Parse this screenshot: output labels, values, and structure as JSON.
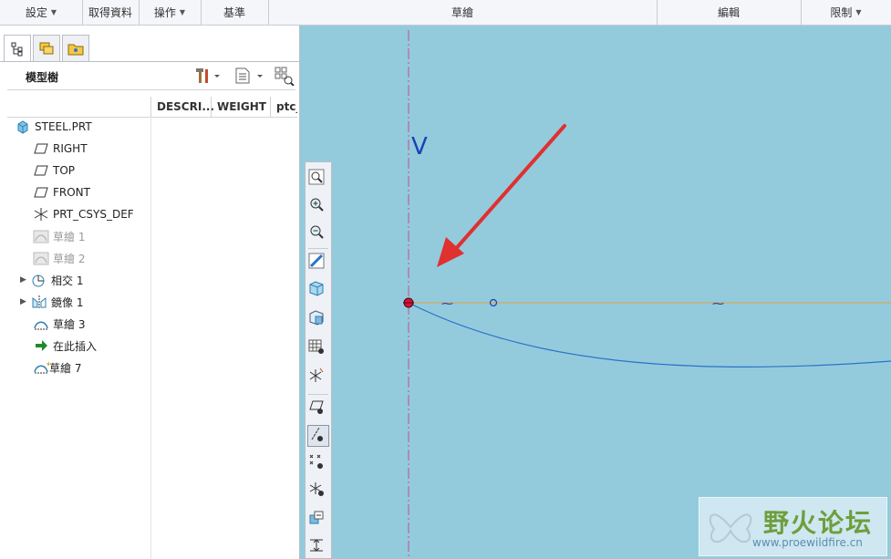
{
  "ribbon": {
    "groups": [
      {
        "label": "設定",
        "dropdown": true
      },
      {
        "label": "取得資料",
        "dropdown": false
      },
      {
        "label": "操作",
        "dropdown": true
      },
      {
        "label": "基準",
        "dropdown": false
      },
      {
        "label": "草繪",
        "dropdown": false
      },
      {
        "label": "編輯",
        "dropdown": false
      },
      {
        "label": "限制",
        "dropdown": true
      }
    ]
  },
  "left_panel": {
    "tabs": [
      {
        "icon": "model-tree-tab-icon",
        "active": true
      },
      {
        "icon": "layers-tab-icon",
        "active": false
      },
      {
        "icon": "favorites-folder-tab-icon",
        "active": false
      }
    ],
    "title": "模型樹",
    "columns": [
      "DESCRI...",
      "WEIGHT",
      "ptc_"
    ],
    "tree": [
      {
        "label": "STEEL.PRT",
        "icon": "part-cube-icon",
        "dim": false,
        "expandable": false,
        "indent": 0
      },
      {
        "label": "RIGHT",
        "icon": "datum-plane-icon",
        "dim": false,
        "expandable": false,
        "indent": 1
      },
      {
        "label": "TOP",
        "icon": "datum-plane-icon",
        "dim": false,
        "expandable": false,
        "indent": 1
      },
      {
        "label": "FRONT",
        "icon": "datum-plane-icon",
        "dim": false,
        "expandable": false,
        "indent": 1
      },
      {
        "label": "PRT_CSYS_DEF",
        "icon": "coordinate-system-icon",
        "dim": false,
        "expandable": false,
        "indent": 1
      },
      {
        "label": "草繪 1",
        "icon": "sketch-icon",
        "dim": true,
        "expandable": false,
        "indent": 1
      },
      {
        "label": "草繪 2",
        "icon": "sketch-icon",
        "dim": true,
        "expandable": false,
        "indent": 1
      },
      {
        "label": "相交 1",
        "icon": "intersect-icon",
        "dim": false,
        "expandable": true,
        "indent": 1
      },
      {
        "label": "鏡像 1",
        "icon": "mirror-icon",
        "dim": false,
        "expandable": true,
        "indent": 1
      },
      {
        "label": "草繪 3",
        "icon": "sketch-icon",
        "dim": false,
        "expandable": false,
        "indent": 1
      },
      {
        "label": "在此插入",
        "icon": "insert-here-arrow-icon",
        "dim": false,
        "expandable": false,
        "indent": 1
      },
      {
        "label": "草繪 7",
        "icon": "sketch-active-icon",
        "dim": false,
        "expandable": false,
        "indent": 1
      }
    ]
  },
  "canvas": {
    "axis_label": "V",
    "background": "#93cbdd",
    "toolbar": [
      "refit-icon",
      "zoom-in-icon",
      "zoom-out-icon",
      "repaint-icon",
      "display-style-icon",
      "saved-orientations-icon",
      "view-manager-icon",
      "datum-display-filters-icon",
      "plane-display-icon",
      "axis-display-icon",
      "point-display-icon",
      "csys-display-icon",
      "sketch-orientation-icon",
      "dimension-display-icon"
    ]
  },
  "watermark": {
    "text": "野火论坛",
    "url": "www.proewildfire.cn"
  }
}
